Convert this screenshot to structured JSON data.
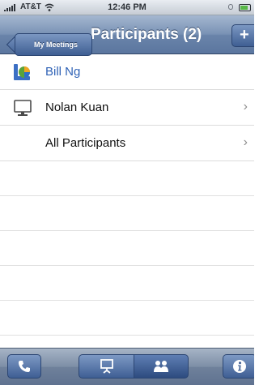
{
  "status_bar": {
    "carrier": "AT&T",
    "time": "12:46 PM"
  },
  "nav_bar": {
    "back_label": "My Meetings",
    "title": "Participants (2)",
    "add_label": "+"
  },
  "participants": [
    {
      "name": "Bill Ng",
      "role": "presenter",
      "icon": "presenter-icon",
      "color": "#2f62b6",
      "has_chevron": false
    },
    {
      "name": "Nolan Kuan",
      "role": "attendee",
      "icon": "monitor-icon",
      "has_chevron": true
    },
    {
      "name": "All Participants",
      "role": "group",
      "icon": "",
      "has_chevron": true
    }
  ],
  "chevron": "›",
  "toolbar": {
    "items": [
      "phone-icon",
      "presentation-icon",
      "participants-icon",
      "info-icon"
    ],
    "info_label": "i",
    "active": "participants-icon"
  },
  "colors": {
    "nav_blue": "#6a84aa",
    "presenter_name": "#2f62b6",
    "battery_green": "#58b848"
  }
}
